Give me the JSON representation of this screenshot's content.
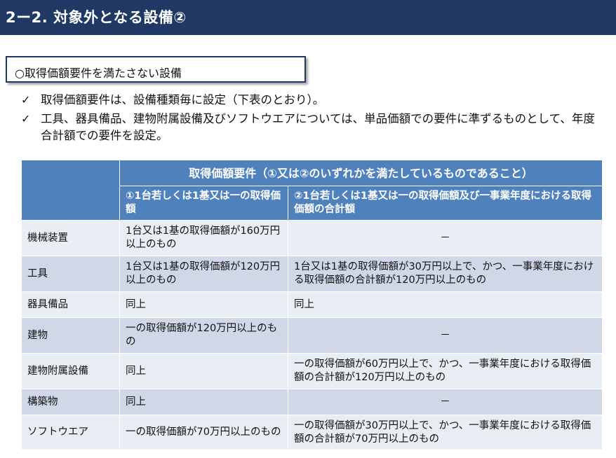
{
  "header": {
    "title": "2ー2. 対象外となる設備②"
  },
  "subtitle": {
    "label": "○取得価額要件を満たさない設備"
  },
  "bullets": [
    {
      "check": "✓",
      "text": "取得価額要件は、設備種類毎に設定（下表のとおり）。"
    },
    {
      "check": "✓",
      "text": "工具、器具備品、建物附属設備及びソフトウエアについては、単品価額での要件に準ずるものとして、年度合計額での要件を設定。"
    }
  ],
  "table": {
    "header_main": "取得価額要件（①又は②のいずれかを満たしているものであること）",
    "col1_header": "①1台若しくは1基又は一の取得価額",
    "col2_header": "②1台若しくは1基又は一の取得価額及び一事業年度における取得価額の合計額",
    "rows": [
      {
        "name": "機械装置",
        "c1": "1台又は1基の取得価額が160万円以上のもの",
        "c2": "－"
      },
      {
        "name": "工具",
        "c1": "1台又は1基の取得価額が120万円以上のもの",
        "c2": "1台又は1基の取得価額が30万円以上で、かつ、一事業年度における取得価額の合計額が120万円以上のもの"
      },
      {
        "name": "器具備品",
        "c1": "同上",
        "c2": "同上"
      },
      {
        "name": "建物",
        "c1": "一の取得価額が120万円以上のもの",
        "c2": "－"
      },
      {
        "name": "建物附属設備",
        "c1": "同上",
        "c2": "一の取得価額が60万円以上で、かつ、一事業年度における取得価額の合計額が120万円以上のもの"
      },
      {
        "name": "構築物",
        "c1": "同上",
        "c2": "－"
      },
      {
        "name": "ソフトウエア",
        "c1": "一の取得価額が70万円以上のもの",
        "c2": "一の取得価額が30万円以上で、かつ、一事業年度における取得価額の合計額が70万円以上のもの"
      }
    ]
  },
  "colors": {
    "title_bg": "#1f3864",
    "header_bg": "#4f81bd",
    "row_light": "#e9edf4",
    "row_dark": "#d0d8e8"
  }
}
